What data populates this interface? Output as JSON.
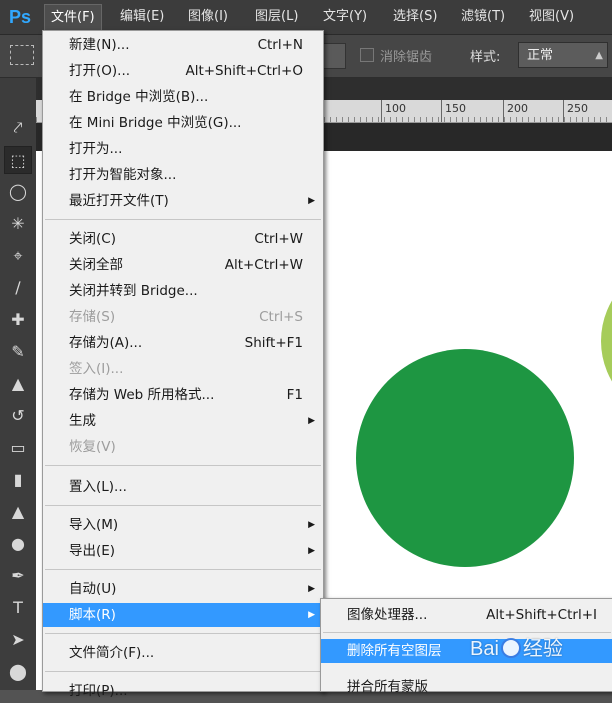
{
  "app": {
    "logo": "Ps"
  },
  "menubar": {
    "items": [
      {
        "label": "文件(F)",
        "active": true
      },
      {
        "label": "编辑(E)"
      },
      {
        "label": "图像(I)"
      },
      {
        "label": "图层(L)"
      },
      {
        "label": "文字(Y)"
      },
      {
        "label": "选择(S)"
      },
      {
        "label": "滤镜(T)"
      },
      {
        "label": "视图(V)"
      }
    ]
  },
  "options": {
    "antialias_label": "消除锯齿",
    "style_label": "样式:",
    "style_value": "正常"
  },
  "ruler": {
    "ticks": [
      "100",
      "150",
      "200",
      "250"
    ]
  },
  "file_menu": {
    "items": [
      {
        "label": "新建(N)...",
        "shortcut": "Ctrl+N"
      },
      {
        "label": "打开(O)...",
        "shortcut": "Alt+Shift+Ctrl+O"
      },
      {
        "label": "在 Bridge 中浏览(B)...",
        "shortcut": ""
      },
      {
        "label": "在 Mini Bridge 中浏览(G)...",
        "shortcut": ""
      },
      {
        "label": "打开为...",
        "shortcut": ""
      },
      {
        "label": "打开为智能对象...",
        "shortcut": ""
      },
      {
        "label": "最近打开文件(T)",
        "shortcut": "",
        "submenu": true
      },
      {
        "label": "关闭(C)",
        "shortcut": "Ctrl+W"
      },
      {
        "label": "关闭全部",
        "shortcut": "Alt+Ctrl+W"
      },
      {
        "label": "关闭并转到 Bridge...",
        "shortcut": ""
      },
      {
        "label": "存储(S)",
        "shortcut": "Ctrl+S",
        "disabled": true
      },
      {
        "label": "存储为(A)...",
        "shortcut": "Shift+F1"
      },
      {
        "label": "签入(I)...",
        "shortcut": "",
        "disabled": true
      },
      {
        "label": "存储为 Web 所用格式...",
        "shortcut": "F1"
      },
      {
        "label": "生成",
        "shortcut": "",
        "submenu": true
      },
      {
        "label": "恢复(V)",
        "shortcut": "",
        "disabled": true
      },
      {
        "label": "置入(L)...",
        "shortcut": ""
      },
      {
        "label": "导入(M)",
        "shortcut": "",
        "submenu": true
      },
      {
        "label": "导出(E)",
        "shortcut": "",
        "submenu": true
      },
      {
        "label": "自动(U)",
        "shortcut": "",
        "submenu": true
      },
      {
        "label": "脚本(R)",
        "shortcut": "",
        "submenu": true,
        "highlighted": true
      },
      {
        "label": "文件简介(F)...",
        "shortcut": ""
      },
      {
        "label": "打印(P)...",
        "shortcut": ""
      }
    ]
  },
  "script_submenu": {
    "items": [
      {
        "label": "图像处理器...",
        "shortcut": "Alt+Shift+Ctrl+I"
      },
      {
        "label": "删除所有空图层",
        "shortcut": "",
        "highlighted": true
      },
      {
        "label": "拼合所有蒙版",
        "shortcut": ""
      }
    ]
  },
  "watermark": {
    "text_a": "Bai",
    "text_b": "经验"
  },
  "colors": {
    "highlight": "#3399ff",
    "circle_dark": "#1e9642",
    "circle_light": "#a6cc5a"
  }
}
